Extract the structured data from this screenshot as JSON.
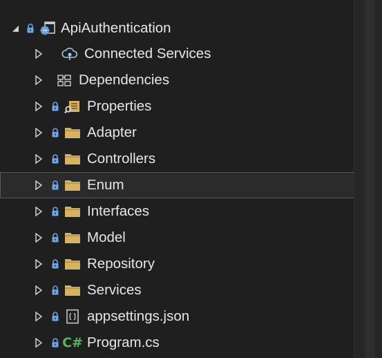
{
  "header_cut_text": "··· ·········· ··· ·········",
  "items": [
    {
      "label": "ApiAuthentication",
      "icon": "web-project-icon",
      "expanded": true,
      "lock": true
    },
    {
      "label": "Connected Services",
      "icon": "connected-services-icon",
      "lock": false
    },
    {
      "label": "Dependencies",
      "icon": "dependencies-icon",
      "lock": false
    },
    {
      "label": "Properties",
      "icon": "properties-icon",
      "lock": true
    },
    {
      "label": "Adapter",
      "icon": "folder-icon",
      "lock": true
    },
    {
      "label": "Controllers",
      "icon": "folder-icon",
      "lock": true
    },
    {
      "label": "Enum",
      "icon": "folder-icon",
      "lock": true,
      "selected": true
    },
    {
      "label": "Interfaces",
      "icon": "folder-icon",
      "lock": true
    },
    {
      "label": "Model",
      "icon": "folder-icon",
      "lock": true
    },
    {
      "label": "Repository",
      "icon": "folder-icon",
      "lock": true
    },
    {
      "label": "Services",
      "icon": "folder-icon",
      "lock": true
    },
    {
      "label": "appsettings.json",
      "icon": "json-file-icon",
      "lock": true
    },
    {
      "label": "Program.cs",
      "icon": "csharp-file-icon",
      "lock": true
    }
  ],
  "csharp_glyph": "C#",
  "colors": {
    "background": "#1f1f1f",
    "folder": "#d7b262",
    "lock": "#6aa6e8",
    "selection_border": "#5a5a5a",
    "csharp": "#57b45c"
  }
}
